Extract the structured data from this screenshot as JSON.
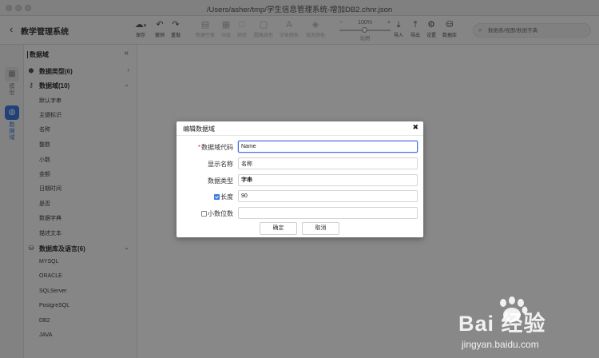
{
  "window": {
    "title": "/Users/asher/tmp/学生信息管理系统-增加DB2.chnr.json"
  },
  "header": {
    "back_icon": "chevron-left-icon",
    "app_title": "教学管理系统"
  },
  "toolbar": {
    "buttons": [
      {
        "label": "保存",
        "icon": "cloud-save-icon",
        "glyph": "☁",
        "enabled": true
      },
      {
        "label": "撤销",
        "icon": "undo-icon",
        "glyph": "↶",
        "enabled": true
      },
      {
        "label": "重做",
        "icon": "redo-icon",
        "glyph": "↷",
        "enabled": true
      },
      {
        "label": "新建空表",
        "icon": "new-table-icon",
        "glyph": "▤",
        "enabled": false
      },
      {
        "label": "分组",
        "icon": "group-icon",
        "glyph": "▦",
        "enabled": false
      },
      {
        "label": "矩形",
        "icon": "rectangle-icon",
        "glyph": "□",
        "enabled": false
      },
      {
        "label": "圆角矩形",
        "icon": "rounded-rect-icon",
        "glyph": "▢",
        "enabled": false
      },
      {
        "label": "字体颜色",
        "icon": "font-color-icon",
        "glyph": "A",
        "enabled": false
      },
      {
        "label": "填充颜色",
        "icon": "fill-color-icon",
        "glyph": "◈",
        "enabled": false
      },
      {
        "label": "导入",
        "icon": "import-icon",
        "glyph": "⤓",
        "enabled": true
      },
      {
        "label": "导出",
        "icon": "export-icon",
        "glyph": "⤒",
        "enabled": true
      },
      {
        "label": "设置",
        "icon": "gear-icon",
        "glyph": "⚙",
        "enabled": true
      },
      {
        "label": "数据库",
        "icon": "database-icon",
        "glyph": "⛁",
        "enabled": true
      }
    ],
    "zoom": {
      "minus": "−",
      "value": "100%",
      "plus": "+",
      "label": "比例",
      "level": 0.5
    },
    "search": {
      "placeholder": "数据表/视图/数据字典",
      "icon": "search-icon"
    }
  },
  "rail": {
    "items": [
      {
        "label": "模型",
        "icon": "model-icon",
        "active": false
      },
      {
        "label": "数据域",
        "icon": "globe-icon",
        "active": true
      }
    ]
  },
  "panel": {
    "title": "数据域",
    "collapse_icon": "double-chevron-left-icon",
    "sections": {
      "data_types": {
        "label": "数据类型(6)",
        "icon": "cube-icon",
        "arrow": "chevron-left-icon"
      },
      "data_domains": {
        "label": "数据域(10)",
        "icon": "key-icon",
        "arrow": "chevron-down-icon",
        "items": [
          "默认字串",
          "主键标识",
          "名称",
          "整数",
          "小数",
          "金额",
          "日期时间",
          "是否",
          "数据字典",
          "描述文本"
        ]
      },
      "databases": {
        "label": "数据库及语言(6)",
        "icon": "database-icon",
        "arrow": "chevron-down-icon",
        "items": [
          "MYSQL",
          "ORACLE",
          "SQLServer",
          "PostgreSQL",
          "DB2",
          "JAVA"
        ]
      }
    }
  },
  "dialog": {
    "title": "编辑数据域",
    "close": "✖",
    "fields": {
      "code": {
        "label": "数据域代码",
        "required": "*",
        "value": "Name"
      },
      "display_name": {
        "label": "显示名称",
        "value": "名称"
      },
      "data_type": {
        "label": "数据类型",
        "value": "字串"
      },
      "length": {
        "label": "长度",
        "checked": true,
        "value": "90"
      },
      "scale": {
        "label": "小数位数",
        "checked": false,
        "value": ""
      }
    },
    "ok_label": "确定",
    "cancel_label": "取消"
  },
  "watermark": {
    "text": "Bai 经验",
    "url": "jingyan.baidu.com"
  },
  "colors": {
    "accent": "#3b7be0",
    "focus_border": "#4a72d9",
    "required": "#e53935",
    "overlay": "rgba(0,0,0,0.46)"
  }
}
